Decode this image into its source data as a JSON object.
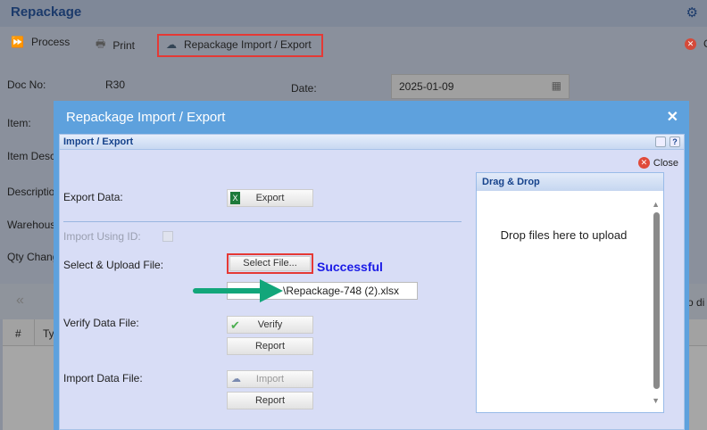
{
  "header": {
    "title": "Repackage"
  },
  "toolbar": {
    "process": "Process",
    "print": "Print",
    "import_export": "Repackage Import / Export",
    "close_partial": "C"
  },
  "form": {
    "doc_no_label": "Doc No:",
    "doc_no": "R30",
    "date_label": "Date:",
    "date": "2025-01-09",
    "item_label": "Item:",
    "item_desc_label": "Item Desc",
    "description_label": "Descriptio",
    "warehouse_label": "Warehous",
    "qty_label": "Qty Chang"
  },
  "grid": {
    "col_hash": "#",
    "col_type": "Ty",
    "right_partial": "o di",
    "nav_first": "«"
  },
  "modal": {
    "title": "Repackage Import / Export",
    "close": "✕",
    "panel_title": "Import / Export",
    "close_label": "Close",
    "export_label": "Export Data:",
    "export_btn": "Export",
    "import_id_label": "Import Using ID:",
    "select_label": "Select & Upload File:",
    "select_btn": "Select File...",
    "status": "Successful",
    "file_path": "\\Repackage-748 (2).xlsx",
    "verify_label": "Verify Data File:",
    "verify_btn": "Verify",
    "verify_report": "Report",
    "import_label": "Import Data File:",
    "import_btn": "Import",
    "import_report": "Report",
    "drag_title": "Drag & Drop",
    "drop_text": "Drop files here to upload"
  },
  "colors": {
    "modal": "#5ea1dd",
    "status": "#1a1ae6",
    "highlight": "#e53935",
    "arrow": "#12a67a"
  }
}
